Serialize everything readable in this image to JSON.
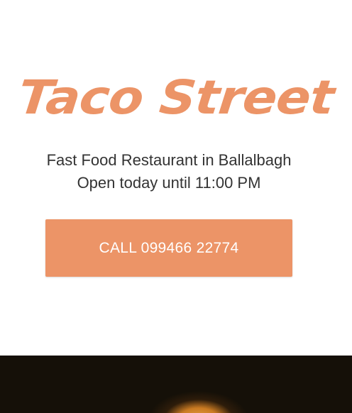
{
  "header": {
    "brand_name": "Taco Street"
  },
  "info": {
    "category_location": "Fast Food Restaurant in Ballalbagh",
    "hours": "Open today until 11:00 PM"
  },
  "actions": {
    "call_label": "CALL 099466 22774"
  },
  "colors": {
    "accent": "#ec9467",
    "text": "#333333",
    "background": "#ffffff",
    "photo_dark": "#151008"
  },
  "hero": {
    "image_subject": "food-photo"
  }
}
